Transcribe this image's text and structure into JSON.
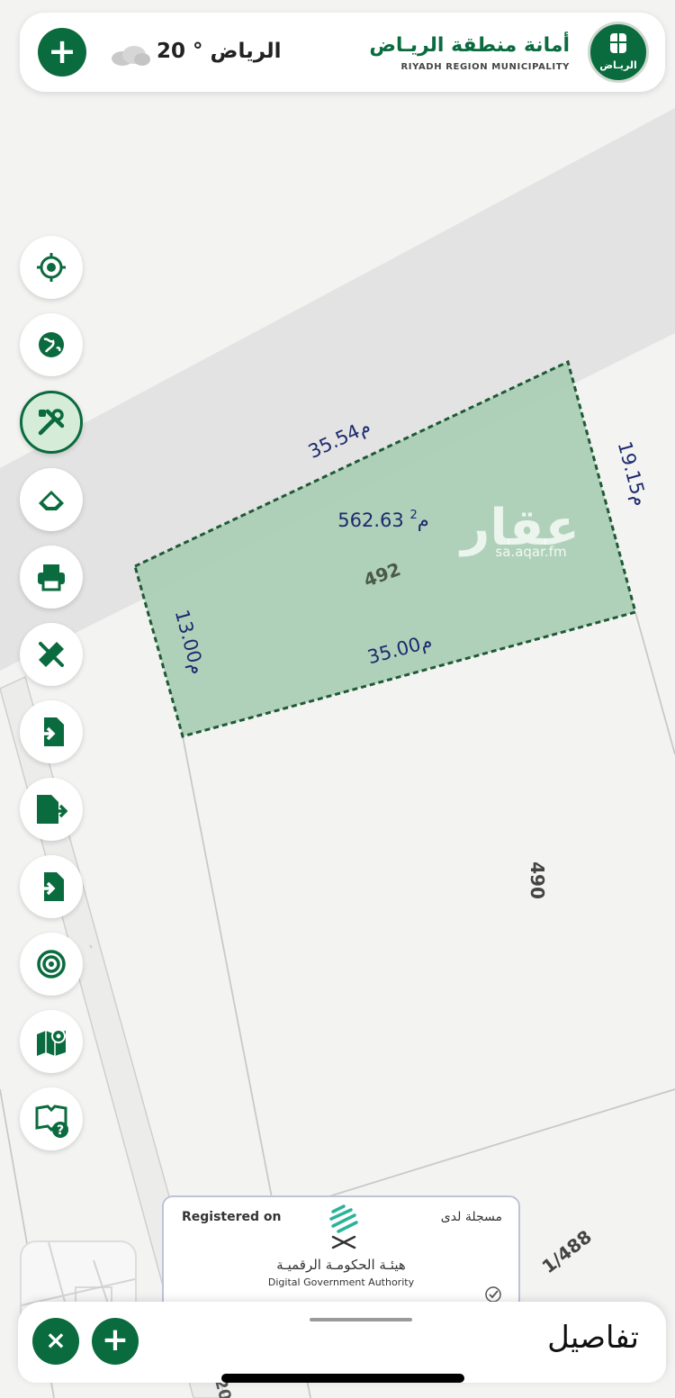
{
  "header": {
    "weather_text": "الرياض ° 20",
    "municipality_ar": "أمانة منطقة الريـاض",
    "municipality_en": "RIYADH REGION MUNICIPALITY",
    "emblem_text": "الريـاض",
    "add_icon": "plus-icon",
    "weather_icon": "cloud-icon"
  },
  "toolbar": {
    "buttons": [
      {
        "name": "locate-button",
        "icon": "crosshair-icon"
      },
      {
        "name": "basemap-button",
        "icon": "globe-icon"
      },
      {
        "name": "tools-button",
        "icon": "tools-icon",
        "active": true
      },
      {
        "name": "eraser-button",
        "icon": "eraser-icon"
      },
      {
        "name": "print-button",
        "icon": "printer-icon"
      },
      {
        "name": "measure-button",
        "icon": "ruler-pencil-icon"
      },
      {
        "name": "import-button",
        "icon": "file-import-icon"
      },
      {
        "name": "export-button",
        "icon": "file-export-icon"
      },
      {
        "name": "import-2-button",
        "icon": "file-import-icon"
      },
      {
        "name": "target-button",
        "icon": "target-icon"
      },
      {
        "name": "map-pin-button",
        "icon": "map-pin-icon"
      },
      {
        "name": "help-button",
        "icon": "book-help-icon"
      }
    ]
  },
  "map": {
    "parcel": {
      "number": "492",
      "area_value": "562.63",
      "area_unit": "م",
      "area_sup": "2",
      "side_top": "35.54م",
      "side_right": "19.15م",
      "side_bottom": "35.00م",
      "side_left": "13.00م",
      "fill_color": "#a9cdb2",
      "border_color": "#1f5a36"
    },
    "neighbor_parcels": [
      "490",
      "1/488"
    ],
    "road_label": "20",
    "watermark_ar": "عقار",
    "watermark_en": "sa.aqar.fm"
  },
  "registration": {
    "registered_en": "Registered on",
    "registered_ar": "مسجلة لدى",
    "authority_ar": "هيئـة الحكومـة الرقميـة",
    "authority_en": "Digital Government Authority"
  },
  "bottom_panel": {
    "title": "تفاصيل",
    "close_label": "×",
    "add_label": "+"
  },
  "colors": {
    "brand_green": "#0a6b3e",
    "road_gray": "#e3e3e3",
    "map_bg": "#f3f3f2"
  }
}
